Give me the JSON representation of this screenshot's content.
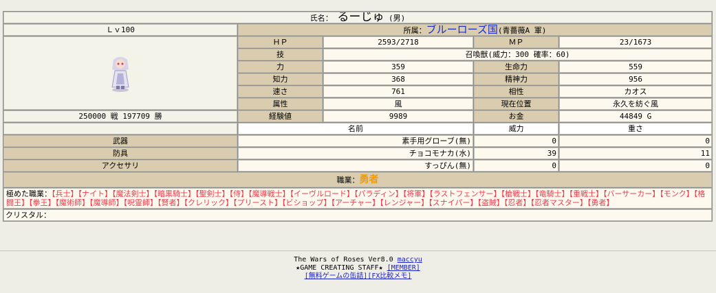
{
  "character": {
    "name_label": "氏名：",
    "name": "るーじゅ",
    "gender": "(男)",
    "level": "Ｌｖ100",
    "record": "250000 戦 197709 勝",
    "affiliation_label": "所属：",
    "affiliation": "ブルーローズ国",
    "affiliation_sub": "(青薔薇A 軍)"
  },
  "stats": {
    "hp_label": "ＨＰ",
    "hp": "2593/2718",
    "mp_label": "ＭＰ",
    "mp": "23/1673",
    "skill_label": "技",
    "skill": "召喚獣(威力：300 確率：60)",
    "str_label": "力",
    "str": "359",
    "vit_label": "生命力",
    "vit": "559",
    "int_label": "知力",
    "int": "368",
    "mnd_label": "精神力",
    "mnd": "956",
    "spd_label": "速さ",
    "spd": "761",
    "aff_label": "相性",
    "aff": "カオス",
    "attr_label": "属性",
    "attr": "風",
    "loc_label": "現在位置",
    "loc": "永久を紡ぐ風",
    "exp_label": "経験値",
    "exp": "9989",
    "gold_label": "お金",
    "gold": "44849 G"
  },
  "equipment": {
    "headers": {
      "name": "名前",
      "power": "威力",
      "weight": "重さ"
    },
    "weapon": {
      "slot": "武器",
      "name": "素手用グローブ(無)",
      "power": "0",
      "weight": "0"
    },
    "armor": {
      "slot": "防具",
      "name": "チョコモナカ(水)",
      "power": "39",
      "weight": "11"
    },
    "accessory": {
      "slot": "アクセサリ",
      "name": "すっぴん(無)",
      "power": "0",
      "weight": "0"
    }
  },
  "job": {
    "label": "職業：",
    "name": "勇者"
  },
  "mastered": {
    "label": "極めた職業：",
    "jobs": [
      "【兵士】",
      "【ナイト】",
      "【魔法剣士】",
      "【暗黒騎士】",
      "【聖剣士】",
      "【侍】",
      "【魔導戦士】",
      "【イーヴルロード】",
      "【パラディン】",
      "【将軍】",
      "【ラストフェンサー】",
      "【槍戦士】",
      "【竜騎士】",
      "【重戦士】",
      "【バーサーカー】",
      "【モンク】",
      "【格闘王】",
      "【拳王】",
      "【魔術師】",
      "【魔導師】",
      "【呪霊師】",
      "【賢者】",
      "【クレリック】",
      "【プリースト】",
      "【ビショップ】",
      "【アーチャー】",
      "【レンジャー】",
      "【スナイパー】",
      "【盗賊】",
      "【忍者】",
      "【忍者マスター】",
      "【勇者】"
    ]
  },
  "crystal": {
    "label": "クリスタル：",
    "value": ""
  },
  "footer": {
    "line1": "The Wars of Roses Ver8.0",
    "author_link": "maccyu",
    "line2": "★GAME CREATING STAFF★",
    "member_link": "[MEMBER]",
    "link3": "[無料ゲームの缶詰]",
    "link4": "[FX比較メモ]"
  }
}
